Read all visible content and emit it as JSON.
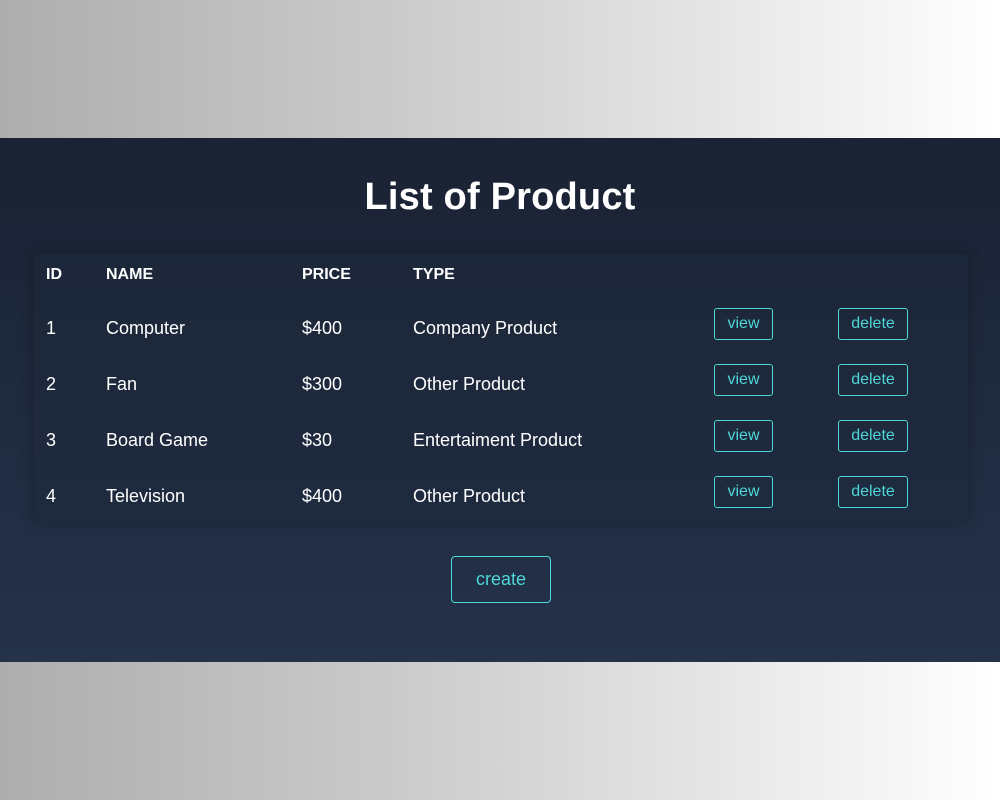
{
  "page": {
    "title": "List of Product"
  },
  "table": {
    "headers": {
      "id": "ID",
      "name": "NAME",
      "price": "PRICE",
      "type": "TYPE"
    },
    "rows": [
      {
        "id": "1",
        "name": "Computer",
        "price": "$400",
        "type": "Company Product",
        "view_label": "view",
        "delete_label": "delete"
      },
      {
        "id": "2",
        "name": "Fan",
        "price": "$300",
        "type": "Other Product",
        "view_label": "view",
        "delete_label": "delete"
      },
      {
        "id": "3",
        "name": "Board Game",
        "price": "$30",
        "type": "Entertaiment Product",
        "view_label": "view",
        "delete_label": "delete"
      },
      {
        "id": "4",
        "name": "Television",
        "price": "$400",
        "type": "Other Product",
        "view_label": "view",
        "delete_label": "delete"
      }
    ]
  },
  "actions": {
    "create_label": "create"
  },
  "colors": {
    "accent": "#4fd6d9",
    "panel_top": "#1a2233",
    "panel_bottom": "#24324a",
    "text": "#ffffff"
  }
}
